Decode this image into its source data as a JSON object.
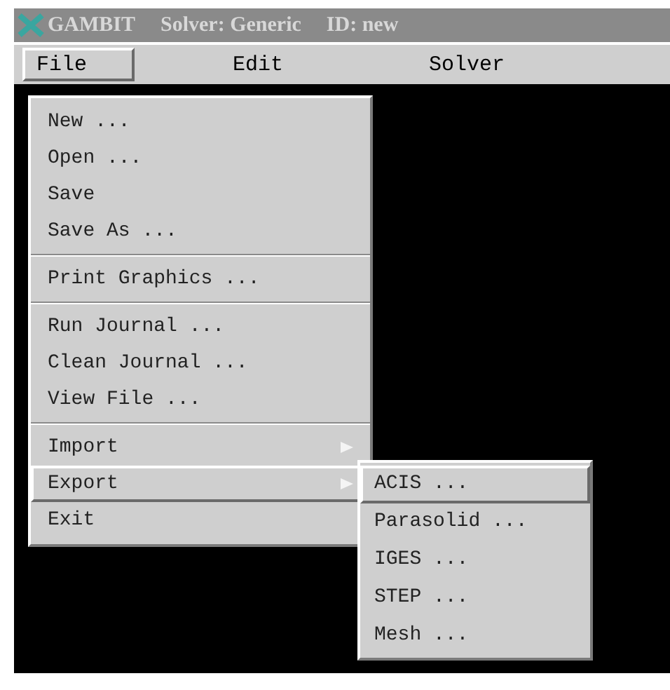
{
  "window": {
    "title": "GAMBIT",
    "subtitle": "Solver: Generic",
    "id_label": "ID: new"
  },
  "menubar": [
    {
      "label": "File",
      "selected": true
    },
    {
      "label": "Edit",
      "selected": false
    },
    {
      "label": "Solver",
      "selected": false
    }
  ],
  "file_menu": [
    {
      "kind": "item",
      "label": "New ...",
      "selected": false,
      "submenu": false
    },
    {
      "kind": "item",
      "label": "Open ...",
      "selected": false,
      "submenu": false
    },
    {
      "kind": "item",
      "label": "Save",
      "selected": false,
      "submenu": false
    },
    {
      "kind": "item",
      "label": "Save As ...",
      "selected": false,
      "submenu": false
    },
    {
      "kind": "separator"
    },
    {
      "kind": "item",
      "label": "Print Graphics ...",
      "selected": false,
      "submenu": false
    },
    {
      "kind": "separator"
    },
    {
      "kind": "item",
      "label": "Run Journal ...",
      "selected": false,
      "submenu": false
    },
    {
      "kind": "item",
      "label": "Clean Journal ...",
      "selected": false,
      "submenu": false
    },
    {
      "kind": "item",
      "label": "View File ...",
      "selected": false,
      "submenu": false
    },
    {
      "kind": "separator"
    },
    {
      "kind": "item",
      "label": "Import",
      "selected": false,
      "submenu": true
    },
    {
      "kind": "item",
      "label": "Export",
      "selected": true,
      "submenu": true
    },
    {
      "kind": "item",
      "label": "Exit",
      "selected": false,
      "submenu": false
    }
  ],
  "export_submenu": [
    {
      "label": "ACIS ...",
      "selected": true
    },
    {
      "label": "Parasolid ...",
      "selected": false
    },
    {
      "label": "IGES ...",
      "selected": false
    },
    {
      "label": "STEP ...",
      "selected": false
    },
    {
      "label": "Mesh ...",
      "selected": false
    }
  ]
}
